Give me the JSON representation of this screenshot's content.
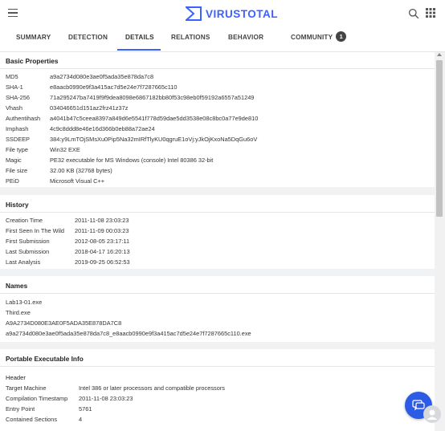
{
  "brand": {
    "name": "VIRUSTOTAL"
  },
  "tabs": [
    {
      "label": "SUMMARY"
    },
    {
      "label": "DETECTION"
    },
    {
      "label": "DETAILS"
    },
    {
      "label": "RELATIONS"
    },
    {
      "label": "BEHAVIOR"
    },
    {
      "label": "COMMUNITY",
      "badge": "1"
    }
  ],
  "active_tab": "DETAILS",
  "basic_properties": {
    "title": "Basic Properties",
    "rows": [
      {
        "key": "MD5",
        "value": "a9a2734d080e3ae0f5ada35e878da7c8"
      },
      {
        "key": "SHA-1",
        "value": "e8aacb0990e9f3a415ac7d5e24e7f7287665c110"
      },
      {
        "key": "SHA-256",
        "value": "71a295247ba7419f9f9dea8098e6867182bb80f53c98eb0f59192a6557a51249"
      },
      {
        "key": "Vhash",
        "value": "034046651d151az2frz41z37z"
      },
      {
        "key": "Authentihash",
        "value": "a4041b47c5ceea8397a849d6e5541f778d59dae5dd3538e08c8bc0a77e9de810"
      },
      {
        "key": "Imphash",
        "value": "4c9c8ddd8e46e16d366b0eb88a72ae24"
      },
      {
        "key": "SSDEEP",
        "value": "384:y9LmTOjSMsXu0Pip5Na32mIRfTlyKU0qgruE1oVj:yJkOjKxoNa5DqGu6oV"
      },
      {
        "key": "File type",
        "value": "Win32 EXE"
      },
      {
        "key": "Magic",
        "value": "PE32 executable for MS Windows (console) Intel 80386 32-bit"
      },
      {
        "key": "File size",
        "value": "32.00 KB (32768 bytes)"
      },
      {
        "key": "PEiD",
        "value": "Microsoft Visual C++"
      }
    ]
  },
  "history": {
    "title": "History",
    "rows": [
      {
        "key": "Creation Time",
        "value": "2011-11-08 23:03:23"
      },
      {
        "key": "First Seen In The Wild",
        "value": "2011-11-09 00:03:23"
      },
      {
        "key": "First Submission",
        "value": "2012-08-05 23:17:11"
      },
      {
        "key": "Last Submission",
        "value": "2018-04-17 16:20:13"
      },
      {
        "key": "Last Analysis",
        "value": "2019-09-25 06:52:53"
      }
    ]
  },
  "names": {
    "title": "Names",
    "items": [
      "Lab13-01.exe",
      "Third.exe",
      "A9A2734D080E3AE0F5ADA35E878DA7C8",
      "a9a2734d080e3ae0f5ada35e878da7c8_e8aacb0990e9f3a415ac7d5e24e7f7287665c110.exe"
    ]
  },
  "pe_info": {
    "title": "Portable Executable Info",
    "header_label": "Header",
    "rows": [
      {
        "key": "Target Machine",
        "value": "Intel 386 or later processors and compatible processors"
      },
      {
        "key": "Compilation Timestamp",
        "value": "2011-11-08 23:03:23"
      },
      {
        "key": "Entry Point",
        "value": "5761"
      },
      {
        "key": "Contained Sections",
        "value": "4"
      }
    ]
  },
  "colors": {
    "brand": "#3b61ff",
    "chat_button": "#2c5ce6",
    "background": "#f1f2f3"
  }
}
